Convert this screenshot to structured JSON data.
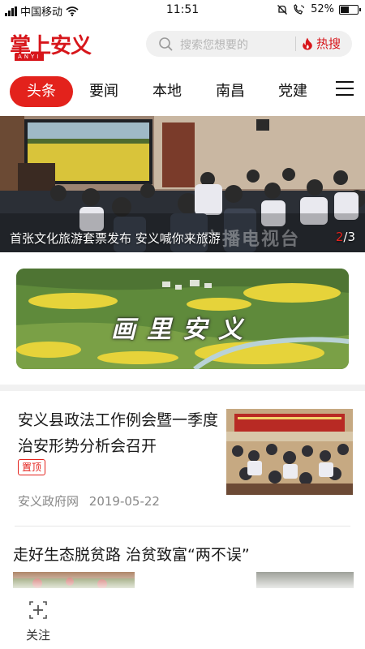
{
  "status_bar": {
    "carrier": "中国移动",
    "time": "11:51",
    "battery_percent": "52%",
    "battery_level": 0.52
  },
  "header": {
    "logo_text": "掌上安义",
    "logo_subtext": "ANYI",
    "search_placeholder": "搜索您想要的",
    "hot_search_label": "热搜"
  },
  "tabs": [
    {
      "label": "头条",
      "active": true
    },
    {
      "label": "要闻",
      "active": false
    },
    {
      "label": "本地",
      "active": false
    },
    {
      "label": "南昌",
      "active": false
    },
    {
      "label": "党建",
      "active": false
    }
  ],
  "hero": {
    "caption": "首张文化旅游套票发布 安义喊你来旅游",
    "current_slide": "2",
    "slide_separator": "/",
    "total_slides": "3",
    "watermark": "广播电视台"
  },
  "banner": {
    "text": "画里安义"
  },
  "articles": [
    {
      "title": "安义县政法工作例会暨一季度治安形势分析会召开",
      "tag": "置顶",
      "source": "安义政府网",
      "date": "2019-05-22"
    },
    {
      "title": "走好生态脱贫路 治贫致富“两不误”"
    }
  ],
  "bottom_nav": {
    "follow_label": "关注"
  },
  "colors": {
    "brand_red": "#e3221c",
    "tag_red": "#e3221c"
  }
}
